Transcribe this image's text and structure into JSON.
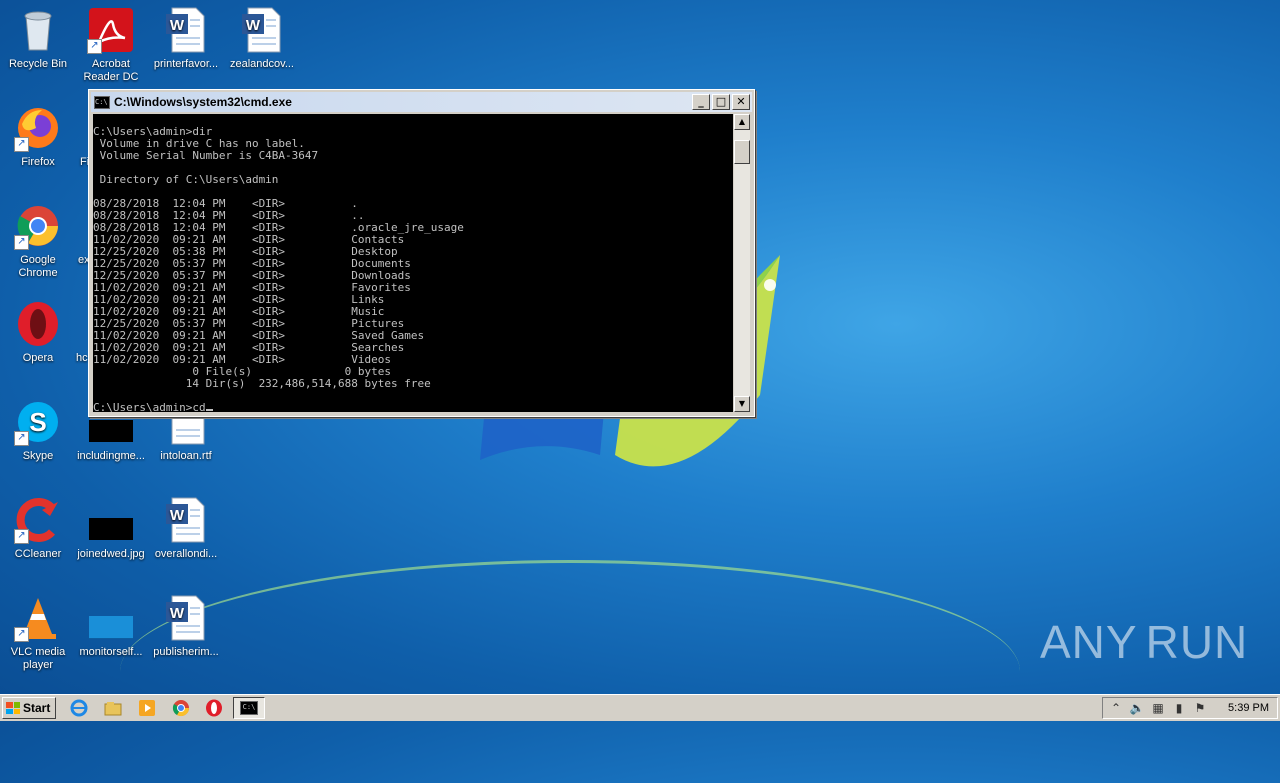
{
  "desktop": {
    "icons": [
      {
        "label": "Recycle Bin"
      },
      {
        "label": "Acrobat Reader DC"
      },
      {
        "label": "printerfavor..."
      },
      {
        "label": "zealandcov..."
      },
      {
        "label": "Firefox"
      },
      {
        "label": "Fi"
      },
      {
        "label": "Google Chrome"
      },
      {
        "label": "ex"
      },
      {
        "label": "Opera"
      },
      {
        "label": "hc"
      },
      {
        "label": "Skype"
      },
      {
        "label": "includingme..."
      },
      {
        "label": "intoloan.rtf"
      },
      {
        "label": "CCleaner"
      },
      {
        "label": "joinedwed.jpg"
      },
      {
        "label": "overallondi..."
      },
      {
        "label": "VLC media player"
      },
      {
        "label": "monitorself..."
      },
      {
        "label": "publisherim..."
      }
    ]
  },
  "watermark": {
    "left": "ANY",
    "right": "RUN"
  },
  "cmd": {
    "title": "C:\\Windows\\system32\\cmd.exe",
    "lines": [
      "C:\\Users\\admin>dir",
      " Volume in drive C has no label.",
      " Volume Serial Number is C4BA-3647",
      "",
      " Directory of C:\\Users\\admin",
      "",
      "08/28/2018  12:04 PM    <DIR>          .",
      "08/28/2018  12:04 PM    <DIR>          ..",
      "08/28/2018  12:04 PM    <DIR>          .oracle_jre_usage",
      "11/02/2020  09:21 AM    <DIR>          Contacts",
      "12/25/2020  05:38 PM    <DIR>          Desktop",
      "12/25/2020  05:37 PM    <DIR>          Documents",
      "12/25/2020  05:37 PM    <DIR>          Downloads",
      "11/02/2020  09:21 AM    <DIR>          Favorites",
      "11/02/2020  09:21 AM    <DIR>          Links",
      "11/02/2020  09:21 AM    <DIR>          Music",
      "12/25/2020  05:37 PM    <DIR>          Pictures",
      "11/02/2020  09:21 AM    <DIR>          Saved Games",
      "11/02/2020  09:21 AM    <DIR>          Searches",
      "11/02/2020  09:21 AM    <DIR>          Videos",
      "               0 File(s)              0 bytes",
      "              14 Dir(s)  232,486,514,688 bytes free",
      "",
      "C:\\Users\\admin>cd"
    ]
  },
  "taskbar": {
    "start_label": "Start",
    "clock": "5:39 PM"
  }
}
